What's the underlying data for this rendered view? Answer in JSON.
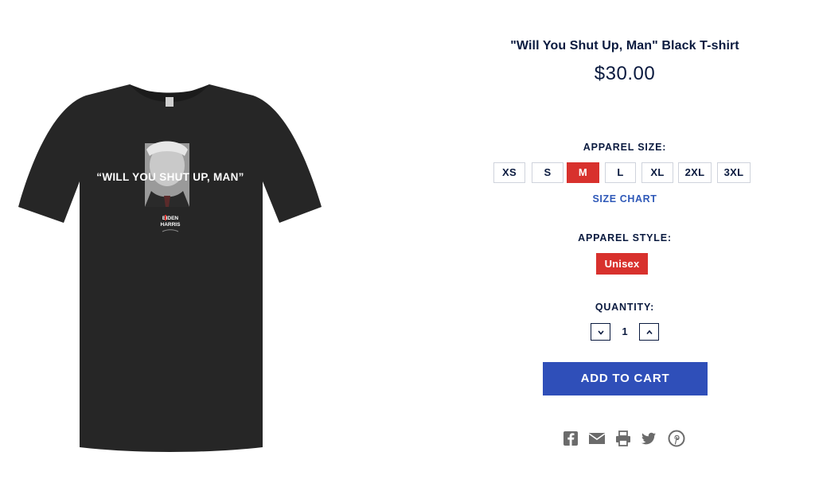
{
  "product": {
    "title": "\"Will You Shut Up, Man\" Black T-shirt",
    "price": "$30.00",
    "image": {
      "shirt_text": "“WILL YOU SHUT UP, MAN”",
      "logo_line1": "BIDEN",
      "logo_line2": "HARRIS",
      "shirt_color": "#262626"
    }
  },
  "options": {
    "size_label": "APPAREL SIZE:",
    "sizes": [
      "XS",
      "S",
      "M",
      "L",
      "XL",
      "2XL",
      "3XL"
    ],
    "selected_size": "M",
    "size_chart_link": "SIZE CHART",
    "style_label": "APPAREL STYLE:",
    "style_value": "Unisex",
    "quantity_label": "QUANTITY:",
    "quantity": "1"
  },
  "cart": {
    "add_label": "ADD TO CART"
  },
  "share": {
    "icons": [
      "facebook-icon",
      "email-icon",
      "print-icon",
      "twitter-icon",
      "pinterest-icon"
    ]
  },
  "colors": {
    "navy": "#0a1a3f",
    "accent_red": "#d8312d",
    "accent_blue": "#2f4fb9",
    "link_blue": "#2f59b8",
    "icon_gray": "#6b6b6b"
  }
}
